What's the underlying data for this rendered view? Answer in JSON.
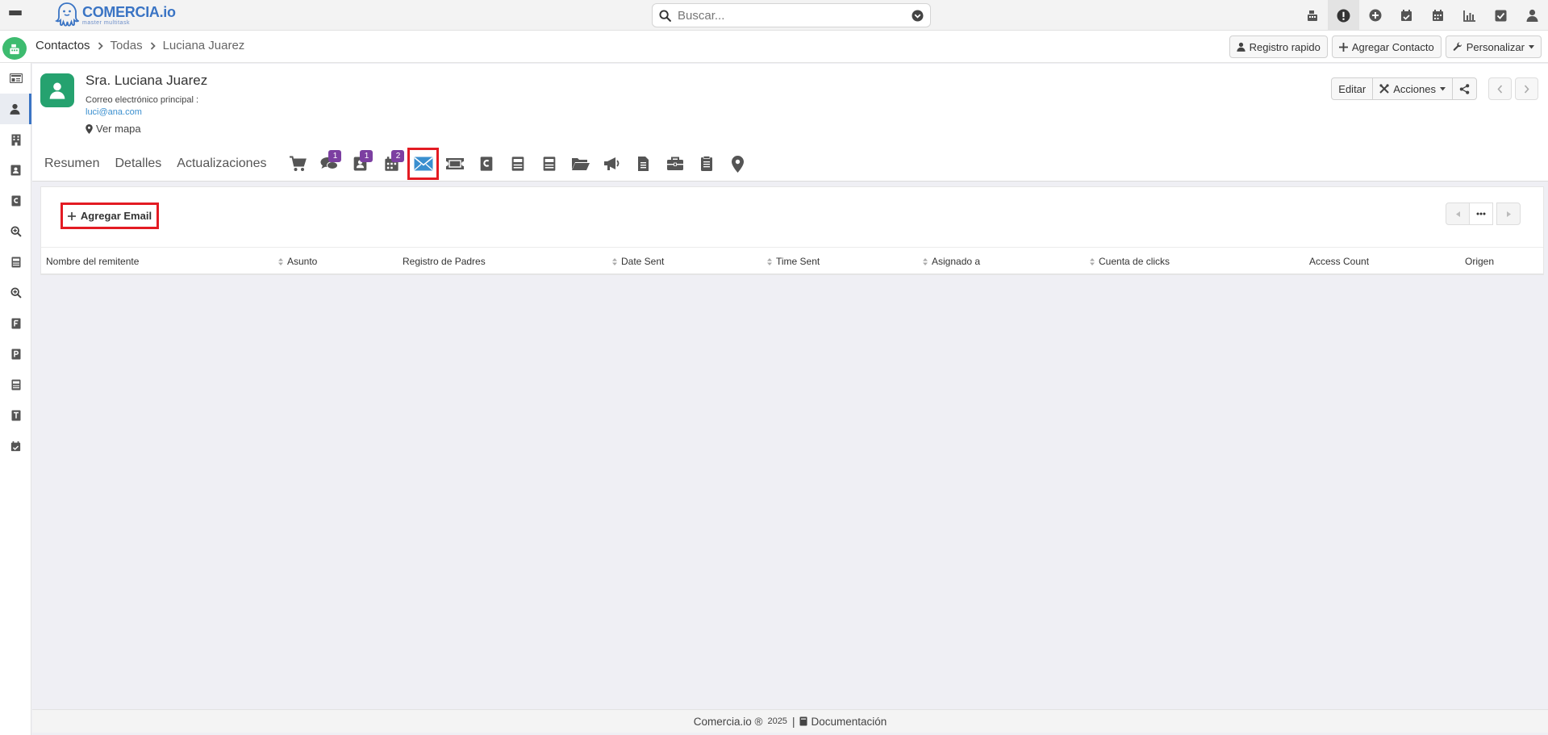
{
  "app": {
    "logo_name": "COMERCIA.io",
    "logo_tagline": "master multitask"
  },
  "search": {
    "placeholder": "Buscar..."
  },
  "breadcrumb": [
    "Contactos",
    "Todas",
    "Luciana Juarez"
  ],
  "header_actions": {
    "quick_register": "Registro rapido",
    "add_contact": "Agregar Contacto",
    "customize": "Personalizar"
  },
  "record": {
    "title": "Sra. Luciana Juarez",
    "email_label": "Correo electrónico principal :",
    "email": "luci@ana.com",
    "map_link": "Ver mapa",
    "edit": "Editar",
    "actions": "Acciones"
  },
  "tabs": {
    "summary": "Resumen",
    "details": "Detalles",
    "updates": "Actualizaciones",
    "badges": {
      "messages": "1",
      "contacts": "1",
      "calendar": "2"
    }
  },
  "subpanel": {
    "add_email": "Agregar Email",
    "columns": [
      "Nombre del remitente",
      "Asunto",
      "Registro de Padres",
      "Date Sent",
      "Time Sent",
      "Asignado a",
      "Cuenta de clicks",
      "Access Count",
      "Origen"
    ]
  },
  "footer": {
    "brand": "Comercia.io ®",
    "year": "2025",
    "separator": "|",
    "docs": "Documentación"
  },
  "colors": {
    "brand_blue": "#3a74c4",
    "module_green": "#3dbb6f",
    "avatar_green": "#25a26f",
    "badge_purple": "#7c3fa1",
    "highlight_red": "#e31b23",
    "link_blue": "#3a8fcf"
  }
}
